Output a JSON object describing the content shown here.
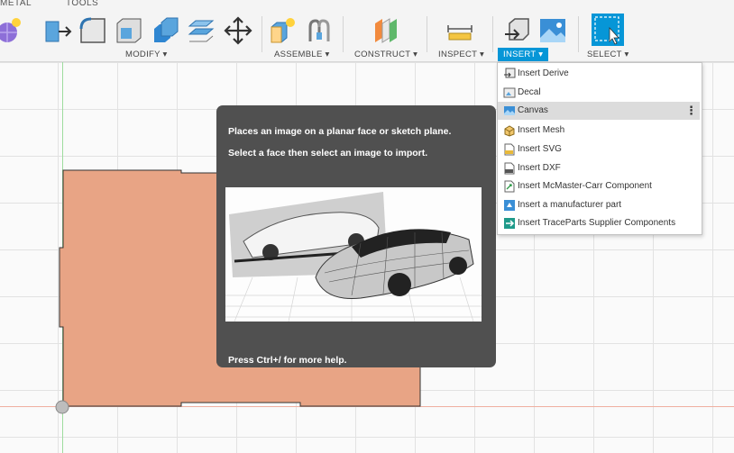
{
  "toolbar": {
    "tabs": [
      "METAL",
      "TOOLS"
    ],
    "groups": {
      "modify": "MODIFY ▾",
      "assemble": "ASSEMBLE ▾",
      "construct": "CONSTRUCT ▾",
      "inspect": "INSPECT ▾",
      "insert": "INSERT ▾",
      "select": "SELECT ▾"
    },
    "accent": "#0696d7"
  },
  "menu": {
    "items": [
      {
        "label": "Insert Derive",
        "icon": "insert-derive-icon"
      },
      {
        "label": "Decal",
        "icon": "decal-icon"
      },
      {
        "label": "Canvas",
        "icon": "canvas-icon",
        "highlighted": true,
        "more": "⋮"
      },
      {
        "label": "Insert Mesh",
        "icon": "insert-mesh-icon"
      },
      {
        "label": "Insert SVG",
        "icon": "svg-file-icon"
      },
      {
        "label": "Insert DXF",
        "icon": "dxf-file-icon"
      },
      {
        "label": "Insert McMaster-Carr Component",
        "icon": "mcmaster-icon"
      },
      {
        "label": "Insert a manufacturer part",
        "icon": "manufacturer-part-icon"
      },
      {
        "label": "Insert TraceParts Supplier Components",
        "icon": "traceparts-icon"
      }
    ]
  },
  "tooltip": {
    "line1": "Places an image on a planar face or sketch plane.",
    "line2": "Select a face then select an image to import.",
    "footer": "Press Ctrl+/ for more help.",
    "image": "car-canvas-illustration"
  },
  "canvas": {
    "part_color": "#e8a485"
  }
}
